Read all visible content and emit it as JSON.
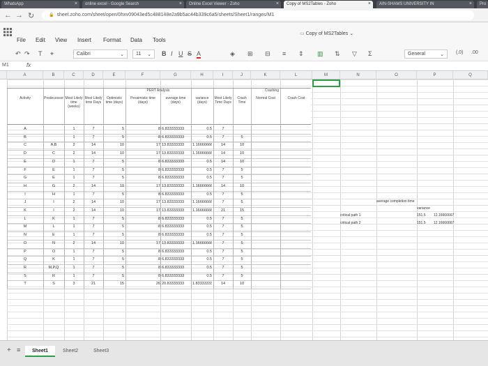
{
  "browser": {
    "tabs": [
      {
        "label": "WhatsApp",
        "active": false
      },
      {
        "label": "online excel - Google Search",
        "active": false
      },
      {
        "label": "Online Excel Viewer - Zoho",
        "active": false
      },
      {
        "label": "Copy of MS2Tables - Zoho",
        "active": true
      },
      {
        "label": "AIN-SHAMS UNIVERSITY IN",
        "active": false
      },
      {
        "label": "Pro",
        "active": false
      }
    ],
    "url": "sheet.zoho.com/sheet/open/0hxv09043ed5c488148e2a9b5ac44b339c6a5/sheets/Sheet1/ranges/M1"
  },
  "app": {
    "document_title": "Copy of MS2Tables",
    "menu": [
      "File",
      "Edit",
      "View",
      "Insert",
      "Format",
      "Data",
      "Tools"
    ]
  },
  "toolbar": {
    "font_name": "Calibri",
    "font_size": "11",
    "bold": "B",
    "italic": "I",
    "underline": "U",
    "strike": "S",
    "font_color": "A",
    "number_format": "General"
  },
  "formula_bar": {
    "cell_ref": "M1",
    "fx": "fx",
    "value": ""
  },
  "columns": [
    "A",
    "B",
    "C",
    "D",
    "E",
    "F",
    "G",
    "H",
    "I",
    "J",
    "K",
    "L",
    "M",
    "N",
    "O",
    "P",
    "Q"
  ],
  "sheet": {
    "pert_title": "PERT Analysis",
    "crashing_title": "Crashing",
    "headers": {
      "activity": "Activity",
      "predecessor": "Predecessor",
      "ml_weeks": "Most Likely time (weeks)",
      "ml_days": "Most Likely time Days",
      "optimistic": "Optimistic time (days)",
      "pessimistic": "Pessimistic time (days)",
      "avg_time": "average time (days)",
      "variance": "variance (days)",
      "ml_time_days": "Most Likely Time Days",
      "crash_time": "Crash Time",
      "normal_cost": "Normal Cost",
      "crash_cost": "Crash Cost"
    },
    "rows": [
      [
        "A",
        "",
        "1",
        "7",
        "5",
        "8",
        "6.833333333",
        "0.5",
        "7",
        ""
      ],
      [
        "B",
        "",
        "1",
        "7",
        "5",
        "8",
        "6.833333333",
        "0.5",
        "7",
        "5"
      ],
      [
        "C",
        "A,B",
        "2",
        "14",
        "10",
        "17",
        "13.83333333",
        "1.166666666",
        "14",
        "10"
      ],
      [
        "D",
        "C",
        "2",
        "14",
        "10",
        "17",
        "13.83333333",
        "1.166666666",
        "14",
        "10"
      ],
      [
        "E",
        "D",
        "1",
        "7",
        "5",
        "8",
        "6.833333333",
        "0.5",
        "14",
        "10"
      ],
      [
        "F",
        "E",
        "1",
        "7",
        "5",
        "8",
        "6.833333333",
        "0.5",
        "7",
        "5"
      ],
      [
        "G",
        "E",
        "1",
        "7",
        "5",
        "8",
        "6.833333333",
        "0.5",
        "7",
        "5"
      ],
      [
        "H",
        "G",
        "2",
        "14",
        "10",
        "17",
        "13.83333333",
        "1.166666666",
        "14",
        "10"
      ],
      [
        "I",
        "H",
        "1",
        "7",
        "5",
        "8",
        "6.833333333",
        "0.5",
        "7",
        "5"
      ],
      [
        "J",
        "I",
        "2",
        "14",
        "10",
        "17",
        "13.83333333",
        "1.166666666",
        "7",
        "5"
      ],
      [
        "K",
        "I",
        "2",
        "14",
        "10",
        "17",
        "13.83333333",
        "1.166666666",
        "21",
        "15"
      ],
      [
        "L",
        "K",
        "1",
        "7",
        "5",
        "8",
        "6.833333333",
        "0.5",
        "7",
        "5"
      ],
      [
        "M",
        "L",
        "1",
        "7",
        "5",
        "8",
        "6.833333333",
        "0.5",
        "7",
        "5"
      ],
      [
        "N",
        "E",
        "1",
        "7",
        "5",
        "8",
        "6.833333333",
        "0.5",
        "7",
        "5"
      ],
      [
        "O",
        "N",
        "2",
        "14",
        "10",
        "17",
        "13.83333333",
        "1.166666666",
        "7",
        "5"
      ],
      [
        "P",
        "O",
        "1",
        "7",
        "5",
        "8",
        "6.833333333",
        "0.5",
        "7",
        "5"
      ],
      [
        "Q",
        "K",
        "1",
        "7",
        "5",
        "8",
        "6.833333333",
        "0.5",
        "7",
        "5"
      ],
      [
        "R",
        "M,P,Q",
        "1",
        "7",
        "5",
        "8",
        "6.833333333",
        "0.5",
        "7",
        "5"
      ],
      [
        "S",
        "R",
        "1",
        "7",
        "5",
        "8",
        "6.833333333",
        "0.5",
        "7",
        "5"
      ],
      [
        "T",
        "S",
        "3",
        "21",
        "15",
        "26",
        "20.83333333",
        "1.833333333",
        "14",
        "10"
      ]
    ],
    "summary": {
      "avg_completion_label": "average completion time",
      "variance_label": "variance",
      "path1_label": "critical path 1",
      "path2_label": "critical path 2",
      "path1_time": "151.5",
      "path1_var": "12.16666667",
      "path2_time": "151.5",
      "path2_var": "12.16666667"
    }
  },
  "sheet_tabs": [
    "Sheet1",
    "Sheet2",
    "Sheet3"
  ],
  "active_sheet": "Sheet1"
}
